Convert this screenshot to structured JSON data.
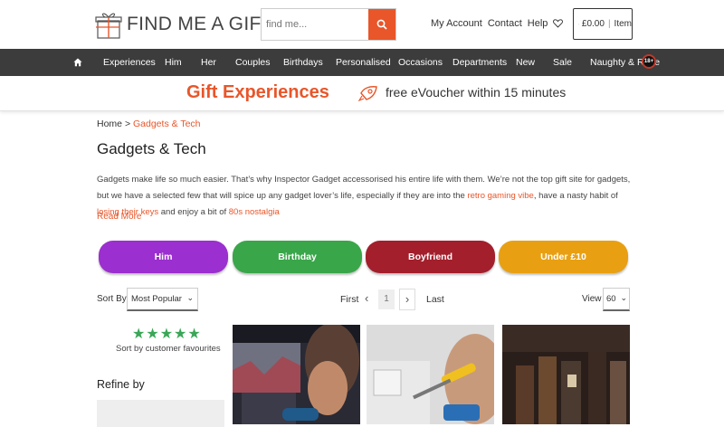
{
  "brand": {
    "logo_text": "FIND ME A GIFT",
    "colors": {
      "accent": "#e8562a",
      "nav_bg": "#3c3c3c",
      "green": "#3aa657"
    }
  },
  "search": {
    "placeholder": "find me...",
    "button_icon": "search-icon"
  },
  "header_links": {
    "account": "My Account",
    "contact": "Contact",
    "help": "Help",
    "wishlist_icon": "heart-icon"
  },
  "basket": {
    "total": "£0.00",
    "count_label": "Item"
  },
  "nav": {
    "home_icon": "home-icon",
    "items": [
      "Experiences",
      "Him",
      "Her",
      "Couples",
      "Birthdays",
      "Personalised",
      "Occasions",
      "Departments",
      "New",
      "Sale",
      "Naughty & Rude"
    ],
    "badge": "18+"
  },
  "promo": {
    "title": "Gift Experiences",
    "subtitle": "free eVoucher within 15 minutes",
    "icon": "rocket-icon"
  },
  "breadcrumb": {
    "home": "Home",
    "separator": ">",
    "current": "Gadgets & Tech"
  },
  "page": {
    "title": "Gadgets & Tech",
    "desc_1": "Gadgets make life so much easier. That’s why Inspector Gadget accessorised his entire life with them. We’re not the top gift site for gadgets, but we have a selected few that will spice up any gadget lover’s life, especially if they are into the ",
    "desc_link_1": "retro gaming vibe",
    "desc_2": ", have a nasty habit of ",
    "desc_link_2": "losing their keys",
    "desc_3": " and enjoy a bit of ",
    "desc_link_3": "80s nostalgia",
    "read_more": "Read More"
  },
  "categories": [
    {
      "label": "Him",
      "color": "#9b2fcf"
    },
    {
      "label": "Birthday",
      "color": "#3aa64a"
    },
    {
      "label": "Boyfriend",
      "color": "#a31f2c"
    },
    {
      "label": "Under £10",
      "color": "#e8a012"
    }
  ],
  "sort": {
    "label": "Sort By",
    "value": "Most Popular"
  },
  "pagination": {
    "first": "First",
    "current_page": "1",
    "last": "Last"
  },
  "view": {
    "label": "View",
    "value": "60"
  },
  "rating": {
    "stars": "★★★★★",
    "caption": "Sort by customer favourites"
  },
  "refine": {
    "title": "Refine by"
  }
}
